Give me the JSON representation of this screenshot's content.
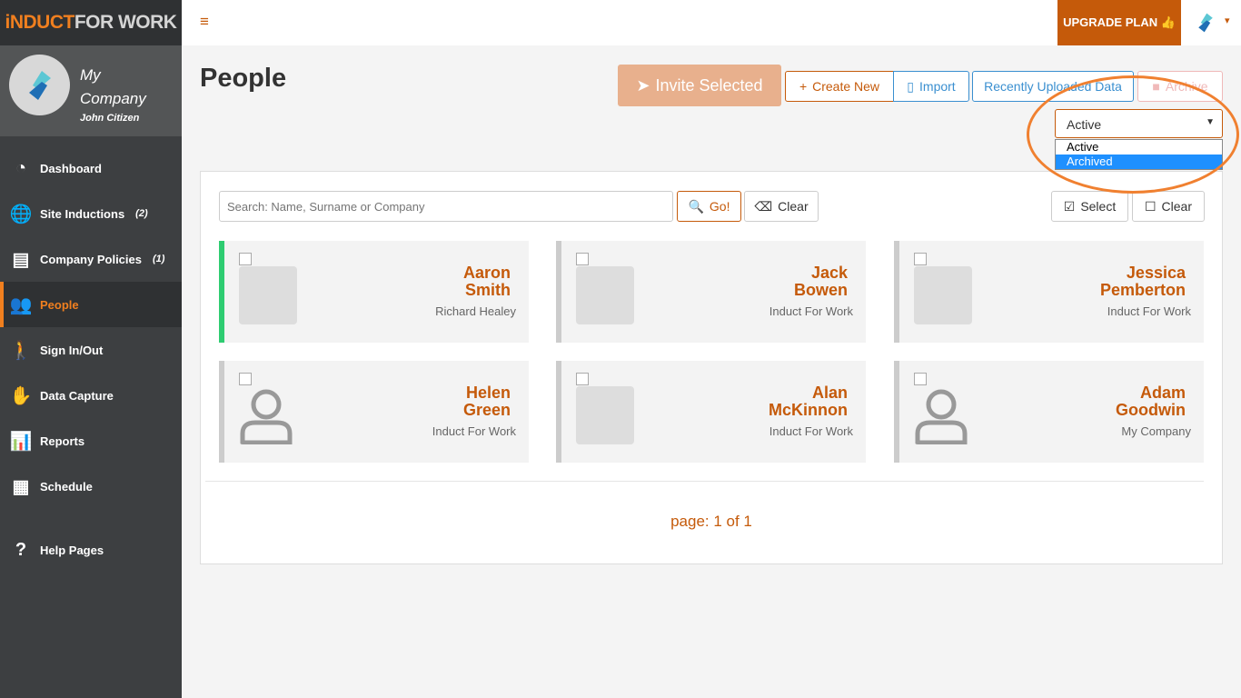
{
  "brand": {
    "part1": "iNDUCT",
    "part2": "FOR WORK"
  },
  "profile": {
    "company": "My Company",
    "user": "John Citizen"
  },
  "sidebar": {
    "items": [
      {
        "label": "Dashboard",
        "icon": "gauge-icon",
        "glyph": "◔",
        "count": ""
      },
      {
        "label": "Site Inductions",
        "icon": "globe-icon",
        "glyph": "🌐",
        "count": "(2)"
      },
      {
        "label": "Company Policies",
        "icon": "book-icon",
        "glyph": "▤",
        "count": "(1)"
      },
      {
        "label": "People",
        "icon": "people-icon",
        "glyph": "👥",
        "count": "",
        "active": true
      },
      {
        "label": "Sign In/Out",
        "icon": "walking-icon",
        "glyph": "🚶",
        "count": ""
      },
      {
        "label": "Data Capture",
        "icon": "hand-icon",
        "glyph": "✋",
        "count": ""
      },
      {
        "label": "Reports",
        "icon": "bar-chart-icon",
        "glyph": "📊",
        "count": ""
      },
      {
        "label": "Schedule",
        "icon": "calendar-icon",
        "glyph": "▦",
        "count": ""
      },
      {
        "label": "Help Pages",
        "icon": "question-icon",
        "glyph": "?",
        "count": ""
      }
    ]
  },
  "topbar": {
    "menu": "≡",
    "upgrade": "UPGRADE PLAN 👍"
  },
  "page": {
    "title": "People"
  },
  "toolbar": {
    "invite": "Invite Selected",
    "create": "Create New",
    "import": "Import",
    "recent": "Recently Uploaded Data",
    "archive": "Archive"
  },
  "filter": {
    "selected": "Active",
    "options": [
      "Active",
      "Archived"
    ],
    "highlighted": "Archived"
  },
  "search": {
    "placeholder": "Search: Name, Surname or Company",
    "go": "Go!",
    "clear": "Clear",
    "select": "Select",
    "clear_selection": "Clear"
  },
  "people": [
    {
      "first": "Aaron",
      "last": "Smith",
      "company": "Richard Healey",
      "photo": true,
      "highlight": true
    },
    {
      "first": "Jack",
      "last": "Bowen",
      "company": "Induct For Work",
      "photo": true
    },
    {
      "first": "Jessica",
      "last": "Pemberton",
      "company": "Induct For Work",
      "photo": true
    },
    {
      "first": "Helen",
      "last": "Green",
      "company": "Induct For Work",
      "photo": false
    },
    {
      "first": "Alan",
      "last": "McKinnon",
      "company": "Induct For Work",
      "photo": true
    },
    {
      "first": "Adam",
      "last": "Goodwin",
      "company": "My Company",
      "photo": false
    }
  ],
  "pagination": "page: 1 of 1",
  "colors": {
    "accent": "#c55a0a",
    "sidebar": "#3d3f41",
    "link": "#3a8fd0"
  }
}
